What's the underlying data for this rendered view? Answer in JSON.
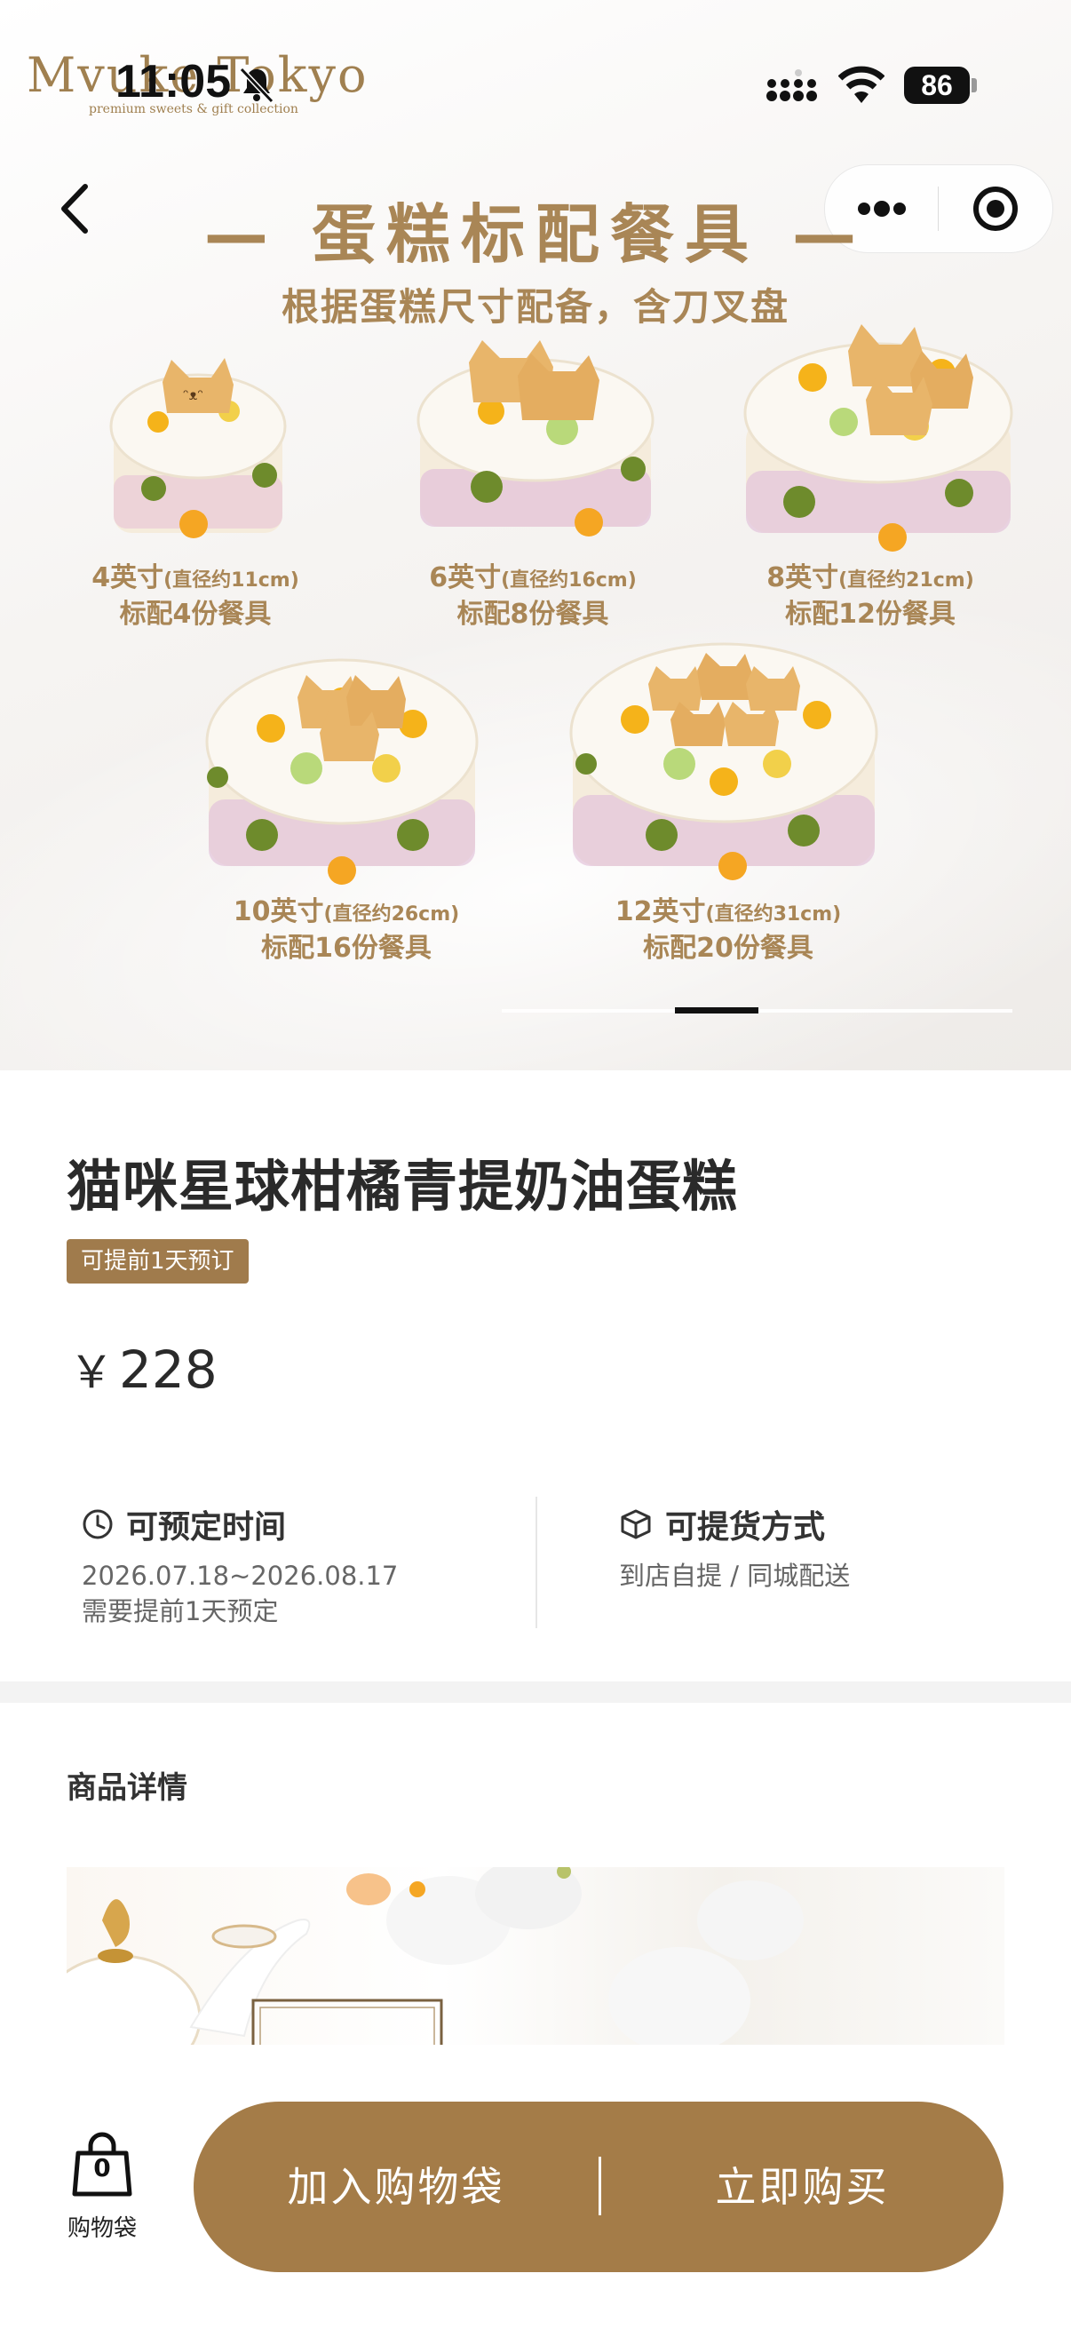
{
  "status_bar": {
    "time": "11:05",
    "battery": "86"
  },
  "brand": {
    "name": "Mvuke Tokyo",
    "tagline": "premium sweets & gift collection"
  },
  "hero": {
    "title": "— 蛋糕标配餐具 —",
    "subtitle": "根据蛋糕尺寸配备，含刀叉盘",
    "sizes": [
      {
        "size": "4英寸",
        "diameter": "(直径约11cm)",
        "set": "标配4份餐具"
      },
      {
        "size": "6英寸",
        "diameter": "(直径约16cm)",
        "set": "标配8份餐具"
      },
      {
        "size": "8英寸",
        "diameter": "(直径约21cm)",
        "set": "标配12份餐具"
      },
      {
        "size": "10英寸",
        "diameter": "(直径约26cm)",
        "set": "标配16份餐具"
      },
      {
        "size": "12英寸",
        "diameter": "(直径约31cm)",
        "set": "标配20份餐具"
      }
    ],
    "carousel_active_index": 1
  },
  "product": {
    "title": "猫咪星球柑橘青提奶油蛋糕",
    "badge": "可提前1天预订",
    "currency": "￥",
    "price": "228"
  },
  "booking": {
    "label": "可预定时间",
    "range": "2026.07.18~2026.08.17",
    "note": "需要提前1天预定"
  },
  "pickup": {
    "label": "可提货方式",
    "methods": "到店自提 / 同城配送"
  },
  "details": {
    "title": "商品详情"
  },
  "bottom_bar": {
    "bag_count": "0",
    "bag_label": "购物袋",
    "add_to_bag": "加入购物袋",
    "buy_now": "立即购买"
  },
  "colors": {
    "accent": "#a47c48",
    "text": "#2a2a2a"
  }
}
